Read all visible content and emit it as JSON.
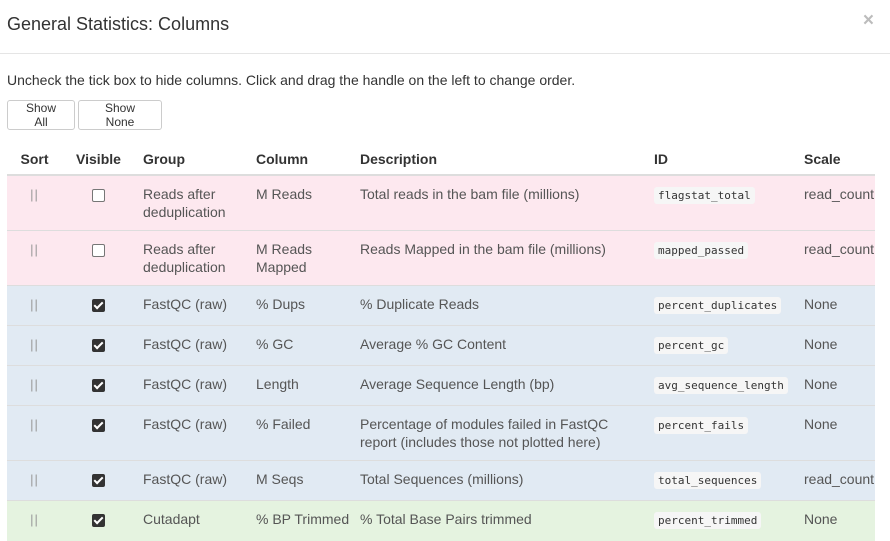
{
  "modal": {
    "title": "General Statistics: Columns",
    "close": "×",
    "help_text": "Uncheck the tick box to hide columns. Click and drag the handle on the left to change order.",
    "show_all": "Show All",
    "show_none": "Show None"
  },
  "table": {
    "headers": [
      "Sort",
      "Visible",
      "Group",
      "Column",
      "Description",
      "ID",
      "Scale"
    ],
    "handle_glyph": "||",
    "rows": [
      {
        "group": "Reads after deduplication",
        "column": "M Reads",
        "description": "Total reads in the bam file (millions)",
        "id": "flagstat_total",
        "scale": "read_count",
        "visible": false,
        "color": "#fde8ef"
      },
      {
        "group": "Reads after deduplication",
        "column": "M Reads Mapped",
        "description": "Reads Mapped in the bam file (millions)",
        "id": "mapped_passed",
        "scale": "read_count",
        "visible": false,
        "color": "#fde8ef"
      },
      {
        "group": "FastQC (raw)",
        "column": "% Dups",
        "description": "% Duplicate Reads",
        "id": "percent_duplicates",
        "scale": "None",
        "visible": true,
        "color": "#e1eaf3"
      },
      {
        "group": "FastQC (raw)",
        "column": "% GC",
        "description": "Average % GC Content",
        "id": "percent_gc",
        "scale": "None",
        "visible": true,
        "color": "#e1eaf3"
      },
      {
        "group": "FastQC (raw)",
        "column": "Length",
        "description": "Average Sequence Length (bp)",
        "id": "avg_sequence_length",
        "scale": "None",
        "visible": true,
        "color": "#e1eaf3"
      },
      {
        "group": "FastQC (raw)",
        "column": "% Failed",
        "description": "Percentage of modules failed in FastQC report (includes those not plotted here)",
        "id": "percent_fails",
        "scale": "None",
        "visible": true,
        "color": "#e1eaf3"
      },
      {
        "group": "FastQC (raw)",
        "column": "M Seqs",
        "description": "Total Sequences (millions)",
        "id": "total_sequences",
        "scale": "read_count",
        "visible": true,
        "color": "#e1eaf3"
      },
      {
        "group": "Cutadapt",
        "column": "% BP Trimmed",
        "description": "% Total Base Pairs trimmed",
        "id": "percent_trimmed",
        "scale": "None",
        "visible": true,
        "color": "#e5f3e0"
      }
    ]
  }
}
